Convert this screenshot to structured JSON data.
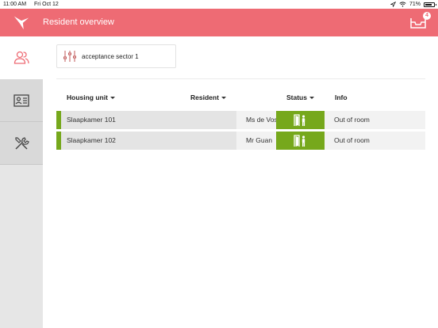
{
  "statusbar": {
    "time": "11:00 AM",
    "date": "Fri Oct 12",
    "battery": "71%"
  },
  "header": {
    "title": "Resident overview",
    "inbox_count": "4"
  },
  "sidebar": {
    "items": [
      {
        "name": "residents",
        "icon": "users-icon",
        "active": true
      },
      {
        "name": "id-card",
        "icon": "id-card-icon",
        "active": false
      },
      {
        "name": "tools",
        "icon": "tools-icon",
        "active": false
      }
    ]
  },
  "filter": {
    "label": "acceptance sector 1"
  },
  "table": {
    "headers": {
      "unit": "Housing unit",
      "resident": "Resident",
      "status": "Status",
      "info": "Info"
    },
    "rows": [
      {
        "unit": "Slaapkamer 101",
        "resident": "Ms de Vos",
        "status_icon": "door-person-icon",
        "info": "Out of room"
      },
      {
        "unit": "Slaapkamer 102",
        "resident": "Mr Guan",
        "status_icon": "door-person-icon",
        "info": "Out of room"
      }
    ]
  },
  "colors": {
    "brand": "#ee6b74",
    "status_green": "#76a81c",
    "sidebar_bg": "#e6e6e6"
  }
}
